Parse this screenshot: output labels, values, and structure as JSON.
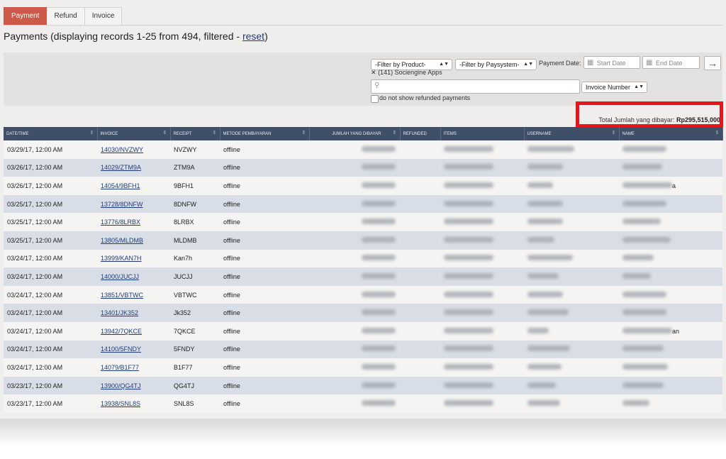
{
  "tabs": [
    {
      "label": "Payment",
      "active": true
    },
    {
      "label": "Refund",
      "active": false
    },
    {
      "label": "Invoice",
      "active": false
    }
  ],
  "page": {
    "title_prefix": "Payments (displaying records 1-25 from 494, filtered - ",
    "reset_link": "reset",
    "title_suffix": ")"
  },
  "filters": {
    "product": "-Filter by Product-",
    "paysystem": "-Filter by Paysystem-",
    "payment_date_label": "Payment Date:",
    "start_date": "Start Date",
    "end_date": "End Date",
    "active_filter": "(141) Sociengine Apps",
    "search_type": "Invoice Number",
    "refund_checkbox_label": "do not show refunded payments"
  },
  "total": {
    "label": "Total Jumlah yang dibayar:",
    "value": "Rp295,515,000"
  },
  "table": {
    "columns": [
      "Date/Time",
      "Invoice",
      "Receipt",
      "Metode Pembayaran",
      "Jumlah Yang Dibayar",
      "Refunded",
      "Items",
      "Username",
      "Name"
    ],
    "rows": [
      {
        "date": "03/29/17, 12:00 AM",
        "invoice": "14030/NVZWY",
        "receipt": "NVZWY",
        "method": "offline",
        "name_extra": ""
      },
      {
        "date": "03/26/17, 12:00 AM",
        "invoice": "14029/ZTM9A",
        "receipt": "ZTM9A",
        "method": "offline",
        "name_extra": ""
      },
      {
        "date": "03/26/17, 12:00 AM",
        "invoice": "14054/9BFH1",
        "receipt": "9BFH1",
        "method": "offline",
        "name_extra": "a"
      },
      {
        "date": "03/25/17, 12:00 AM",
        "invoice": "13728/8DNFW",
        "receipt": "8DNFW",
        "method": "offline",
        "name_extra": ""
      },
      {
        "date": "03/25/17, 12:00 AM",
        "invoice": "13776/8LRBX",
        "receipt": "8LRBX",
        "method": "offline",
        "name_extra": ""
      },
      {
        "date": "03/25/17, 12:00 AM",
        "invoice": "13805/MLDMB",
        "receipt": "MLDMB",
        "method": "offline",
        "name_extra": ""
      },
      {
        "date": "03/24/17, 12:00 AM",
        "invoice": "13999/KAN7H",
        "receipt": "Kan7h",
        "method": "offline",
        "name_extra": ""
      },
      {
        "date": "03/24/17, 12:00 AM",
        "invoice": "14000/JUCJJ",
        "receipt": "JUCJJ",
        "method": "offline",
        "name_extra": ""
      },
      {
        "date": "03/24/17, 12:00 AM",
        "invoice": "13851/VBTWC",
        "receipt": "VBTWC",
        "method": "offline",
        "name_extra": ""
      },
      {
        "date": "03/24/17, 12:00 AM",
        "invoice": "13401/JK352",
        "receipt": "Jk352",
        "method": "offline",
        "name_extra": ""
      },
      {
        "date": "03/24/17, 12:00 AM",
        "invoice": "13942/7QKCE",
        "receipt": "7QKCE",
        "method": "offline",
        "name_extra": "an"
      },
      {
        "date": "03/24/17, 12:00 AM",
        "invoice": "14100/5FNDY",
        "receipt": "5FNDY",
        "method": "offline",
        "name_extra": ""
      },
      {
        "date": "03/24/17, 12:00 AM",
        "invoice": "14079/B1F77",
        "receipt": "B1F77",
        "method": "offline",
        "name_extra": ""
      },
      {
        "date": "03/23/17, 12:00 AM",
        "invoice": "13900/QG4TJ",
        "receipt": "QG4TJ",
        "method": "offline",
        "name_extra": ""
      },
      {
        "date": "03/23/17, 12:00 AM",
        "invoice": "13938/SNL8S",
        "receipt": "SNL8S",
        "method": "offline",
        "name_extra": ""
      }
    ]
  }
}
